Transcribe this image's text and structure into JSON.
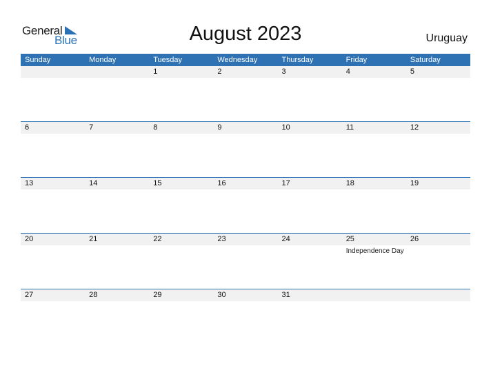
{
  "logo": {
    "line1": "General",
    "line2": "Blue"
  },
  "title": "August 2023",
  "country": "Uruguay",
  "colors": {
    "accent": "#2e72b3",
    "date_strip": "#f1f1f1"
  },
  "weekdays": [
    "Sunday",
    "Monday",
    "Tuesday",
    "Wednesday",
    "Thursday",
    "Friday",
    "Saturday"
  ],
  "weeks": [
    [
      {
        "d": ""
      },
      {
        "d": ""
      },
      {
        "d": "1"
      },
      {
        "d": "2"
      },
      {
        "d": "3"
      },
      {
        "d": "4"
      },
      {
        "d": "5"
      }
    ],
    [
      {
        "d": "6"
      },
      {
        "d": "7"
      },
      {
        "d": "8"
      },
      {
        "d": "9"
      },
      {
        "d": "10"
      },
      {
        "d": "11"
      },
      {
        "d": "12"
      }
    ],
    [
      {
        "d": "13"
      },
      {
        "d": "14"
      },
      {
        "d": "15"
      },
      {
        "d": "16"
      },
      {
        "d": "17"
      },
      {
        "d": "18"
      },
      {
        "d": "19"
      }
    ],
    [
      {
        "d": "20"
      },
      {
        "d": "21"
      },
      {
        "d": "22"
      },
      {
        "d": "23"
      },
      {
        "d": "24"
      },
      {
        "d": "25",
        "holiday": "Independence Day"
      },
      {
        "d": "26"
      }
    ],
    [
      {
        "d": "27"
      },
      {
        "d": "28"
      },
      {
        "d": "29"
      },
      {
        "d": "30"
      },
      {
        "d": "31"
      },
      {
        "d": ""
      },
      {
        "d": ""
      }
    ]
  ]
}
